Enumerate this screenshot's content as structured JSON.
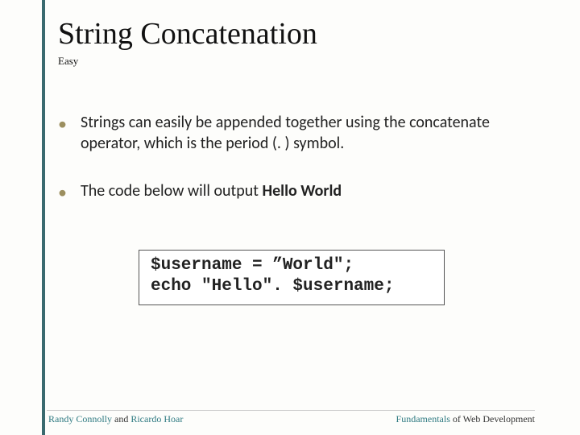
{
  "title": "String Concatenation",
  "subtitle": "Easy",
  "bullets": [
    {
      "text": "Strings can easily be appended together using the concatenate operator, which is the period (. ) symbol."
    },
    {
      "prefix": "The code below will output ",
      "bold": "Hello World"
    }
  ],
  "code": {
    "line1": "$username = ”World\";",
    "line2": "echo \"Hello\". $username;"
  },
  "footer": {
    "left_a": "Randy Connolly",
    "left_mid": " and ",
    "left_b": "Ricardo Hoar",
    "right_a": "Fundamentals",
    "right_b": " of Web Development"
  }
}
